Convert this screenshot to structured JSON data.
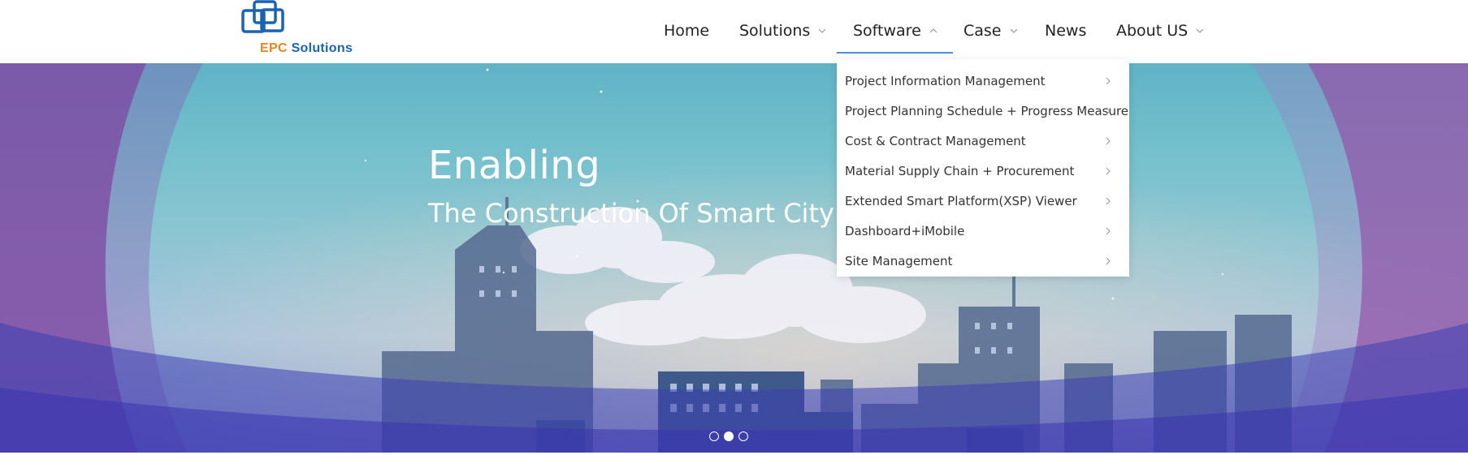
{
  "logo": {
    "text_epc": "EPC",
    "text_solutions": "Solutions",
    "brand_blue": "#1a63b3",
    "brand_orange": "#e8841f"
  },
  "nav": {
    "home": "Home",
    "solutions": "Solutions",
    "software": "Software",
    "case": "Case",
    "news": "News",
    "about": "About US",
    "active_item": "Software",
    "active_underline_color": "#4a8fd8"
  },
  "dropdown": {
    "items": [
      {
        "label": "Project Information Management"
      },
      {
        "label": "Project Planning Schedule + Progress Measure"
      },
      {
        "label": "Cost & Contract Management"
      },
      {
        "label": "Material Supply Chain + Procurement"
      },
      {
        "label": "Extended Smart Platform(XSP) Viewer"
      },
      {
        "label": "Dashboard+iMobile"
      },
      {
        "label": "Site Management"
      }
    ]
  },
  "hero": {
    "title": "Enabling",
    "subtitle": "The Construction Of Smart City A",
    "slides_total": 3,
    "active_slide": 2
  }
}
